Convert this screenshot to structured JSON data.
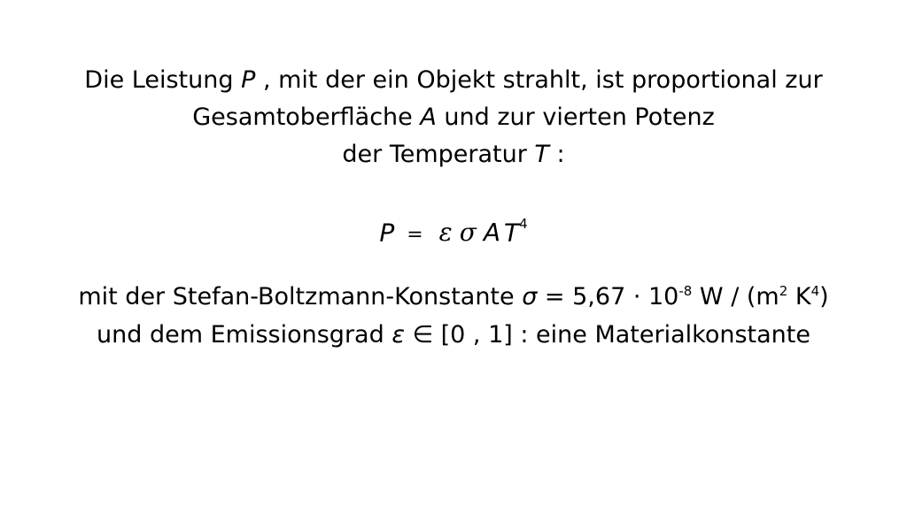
{
  "paragraph": {
    "line1_before": "Die Leistung ",
    "var_p": "P",
    "line1_after": " , mit der ein Objekt strahlt, ist proportional zur",
    "line2_before": "Gesamtoberfläche ",
    "var_a": "A",
    "line2_after": " und zur vierten Potenz",
    "line3_before": "der Temperatur ",
    "var_t": "T",
    "line3_after": " :"
  },
  "formula": {
    "lhs": "P",
    "equals": "=",
    "epsilon": "ε",
    "sigma": "σ",
    "area": "A",
    "temp": "T",
    "exponent": "4"
  },
  "notes": {
    "line4_before": "mit der Stefan-Boltzmann-Konstante ",
    "sigma": "σ",
    "line4_value": " = 5,67 · 10",
    "exp_neg8": "-8",
    "line4_unit": " W / (m",
    "exp_2": "2",
    "line4_unit_k": " K",
    "exp_4": "4",
    "line4_close": ")",
    "line5_before": "und dem Emissionsgrad ",
    "epsilon": "ε",
    "line5_after": " ∈ [0 , 1] : eine Materialkonstante"
  }
}
